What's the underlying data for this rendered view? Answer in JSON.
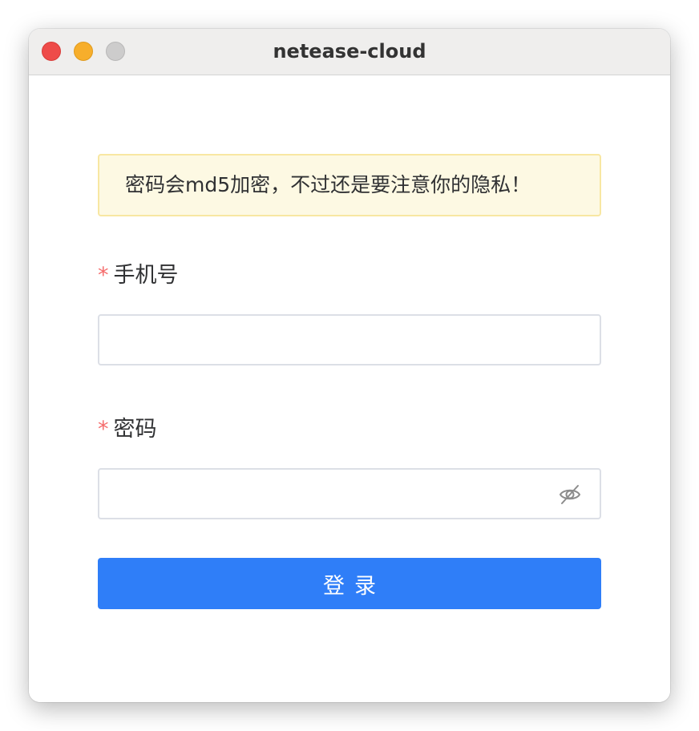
{
  "window": {
    "title": "netease-cloud"
  },
  "notice": {
    "text": "密码会md5加密，不过还是要注意你的隐私！"
  },
  "form": {
    "phone": {
      "required_mark": "*",
      "label": "手机号",
      "value": "",
      "placeholder": ""
    },
    "password": {
      "required_mark": "*",
      "label": "密码",
      "value": "",
      "placeholder": "",
      "toggle_icon": "eye-off-icon"
    },
    "submit_label": "登录"
  },
  "colors": {
    "primary": "#2f7ef8",
    "required": "#f56c6c",
    "notice_bg": "#fdf9e3",
    "notice_border": "#f8e7a2",
    "close": "#ee4b49",
    "minimize": "#f7ae2b",
    "maximize": "#cdcccc"
  }
}
